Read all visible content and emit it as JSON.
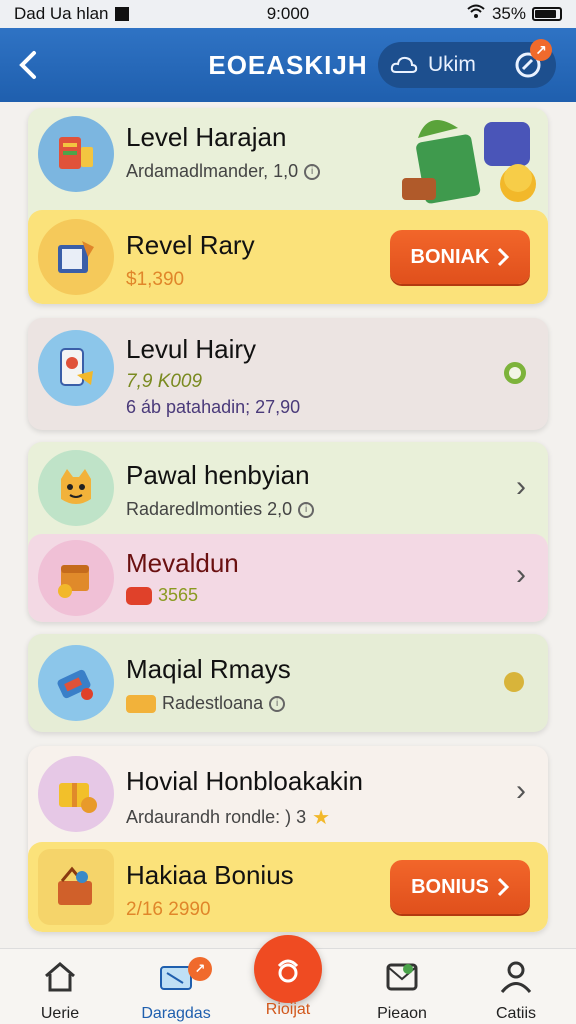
{
  "status": {
    "carrier": "Dad Ua hlan",
    "time": "9:000",
    "battery": "35%"
  },
  "header": {
    "title": "EOEASKIJH",
    "pill_label": "Ukim",
    "badge": "↗"
  },
  "cards": [
    {
      "title": "Level Harajan",
      "sub": "Ardamadlmander, 1,0"
    },
    {
      "title": "Revel Rary",
      "value": "$1,390"
    },
    {
      "title": "Levul Hairy",
      "value": "7,9 K009",
      "sub": "6 áb patahadin; 27,90"
    },
    {
      "title": "Pawal henbyian",
      "sub": "Radaredlmonties 2,0"
    },
    {
      "title": "Mevaldun",
      "value": "3565"
    },
    {
      "title": "Maqial Rmays",
      "sub": "Radestloana"
    },
    {
      "title": "Hovial Honbloakakin",
      "sub": "Ardaurandh rondle: ) 3"
    },
    {
      "title": "Hakiaa Bonius",
      "value": "2/16 2990"
    }
  ],
  "buttons": {
    "cta1": "BONIAK",
    "cta2": "BONIUS"
  },
  "tabs": [
    {
      "label": "Uerie"
    },
    {
      "label": "Daragdas",
      "badge": "↗"
    },
    {
      "label": "Rioijat"
    },
    {
      "label": "Pieaon"
    },
    {
      "label": "Catiis"
    }
  ]
}
